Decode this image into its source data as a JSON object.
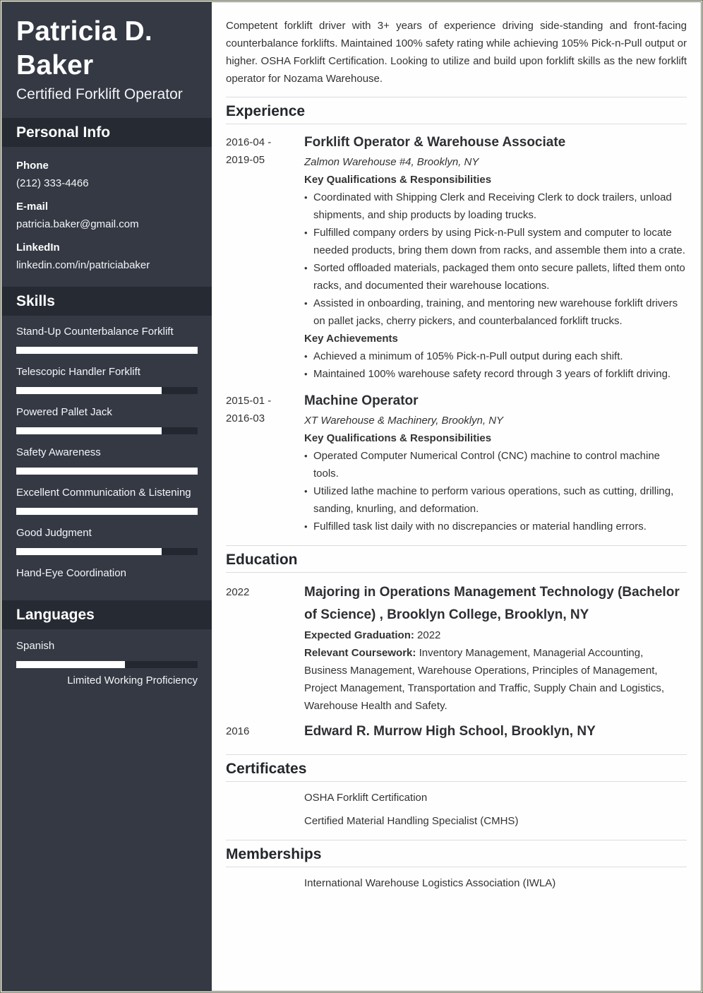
{
  "header": {
    "name": "Patricia D. Baker",
    "title": "Certified Forklift Operator"
  },
  "personal_info": {
    "heading": "Personal Info",
    "items": [
      {
        "label": "Phone",
        "value": "(212) 333-4466"
      },
      {
        "label": "E-mail",
        "value": "patricia.baker@gmail.com"
      },
      {
        "label": "LinkedIn",
        "value": "linkedin.com/in/patriciabaker"
      }
    ]
  },
  "skills": {
    "heading": "Skills",
    "items": [
      {
        "name": "Stand-Up Counterbalance Forklift",
        "level": 1.0
      },
      {
        "name": "Telescopic Handler Forklift",
        "level": 0.8
      },
      {
        "name": "Powered Pallet Jack",
        "level": 0.8
      },
      {
        "name": "Safety Awareness",
        "level": 1.0
      },
      {
        "name": "Excellent Communication & Listening",
        "level": 1.0
      },
      {
        "name": "Good Judgment",
        "level": 0.8
      },
      {
        "name": "Hand-Eye Coordination",
        "level": null
      }
    ]
  },
  "languages": {
    "heading": "Languages",
    "items": [
      {
        "name": "Spanish",
        "level": 0.6,
        "proficiency": "Limited Working Proficiency"
      }
    ]
  },
  "summary": "Competent forklift driver with 3+ years of experience driving side-standing and front-facing counterbalance forklifts. Maintained 100% safety rating while achieving 105% Pick-n-Pull output or higher. OSHA Forklift Certification. Looking to utilize and build upon forklift skills as the new forklift operator for Nozama Warehouse.",
  "experience": {
    "heading": "Experience",
    "jobs": [
      {
        "date_start": "2016-04 -",
        "date_end": "2019-05",
        "title": "Forklift Operator & Warehouse Associate",
        "place": "Zalmon Warehouse #4, Brooklyn, NY",
        "resp_heading": "Key Qualifications & Responsibilities",
        "responsibilities": [
          "Coordinated with Shipping Clerk and Receiving Clerk to dock trailers, unload shipments, and ship products by loading trucks.",
          "Fulfilled company orders by using Pick-n-Pull system and computer to locate needed products, bring them down from racks, and assemble them into a crate.",
          "Sorted offloaded materials, packaged them onto secure pallets, lifted them onto racks, and documented their warehouse locations.",
          "Assisted in onboarding, training, and mentoring new warehouse forklift drivers on pallet jacks, cherry pickers, and counterbalanced forklift trucks."
        ],
        "ach_heading": "Key Achievements",
        "achievements": [
          "Achieved a minimum of 105% Pick-n-Pull output during each shift.",
          "Maintained 100% warehouse safety record through 3 years of forklift driving."
        ]
      },
      {
        "date_start": "2015-01 -",
        "date_end": "2016-03",
        "title": "Machine Operator",
        "place": "XT Warehouse & Machinery, Brooklyn, NY",
        "resp_heading": "Key Qualifications & Responsibilities",
        "responsibilities": [
          "Operated Computer Numerical Control (CNC) machine to control machine tools.",
          "Utilized lathe machine to perform various operations, such as cutting, drilling, sanding, knurling, and deformation.",
          "Fulfilled task list daily with no discrepancies or material handling errors."
        ]
      }
    ]
  },
  "education": {
    "heading": "Education",
    "items": [
      {
        "date": "2022",
        "title": "Majoring in Operations Management Technology (Bachelor of Science) , Brooklyn College, Brooklyn, NY",
        "grad_label": "Expected Graduation:",
        "grad_value": "2022",
        "course_label": "Relevant Coursework:",
        "course_value": "Inventory Management, Managerial Accounting, Business Management, Warehouse Operations, Principles of Management, Project Management, Transportation and Traffic, Supply Chain and Logistics, Warehouse Health and Safety."
      },
      {
        "date": "2016",
        "title": "Edward R. Murrow High School, Brooklyn, NY"
      }
    ]
  },
  "certificates": {
    "heading": "Certificates",
    "items": [
      "OSHA Forklift Certification",
      "Certified Material Handling Specialist (CMHS)"
    ]
  },
  "memberships": {
    "heading": "Memberships",
    "items": [
      "International Warehouse Logistics Association (IWLA)"
    ]
  }
}
